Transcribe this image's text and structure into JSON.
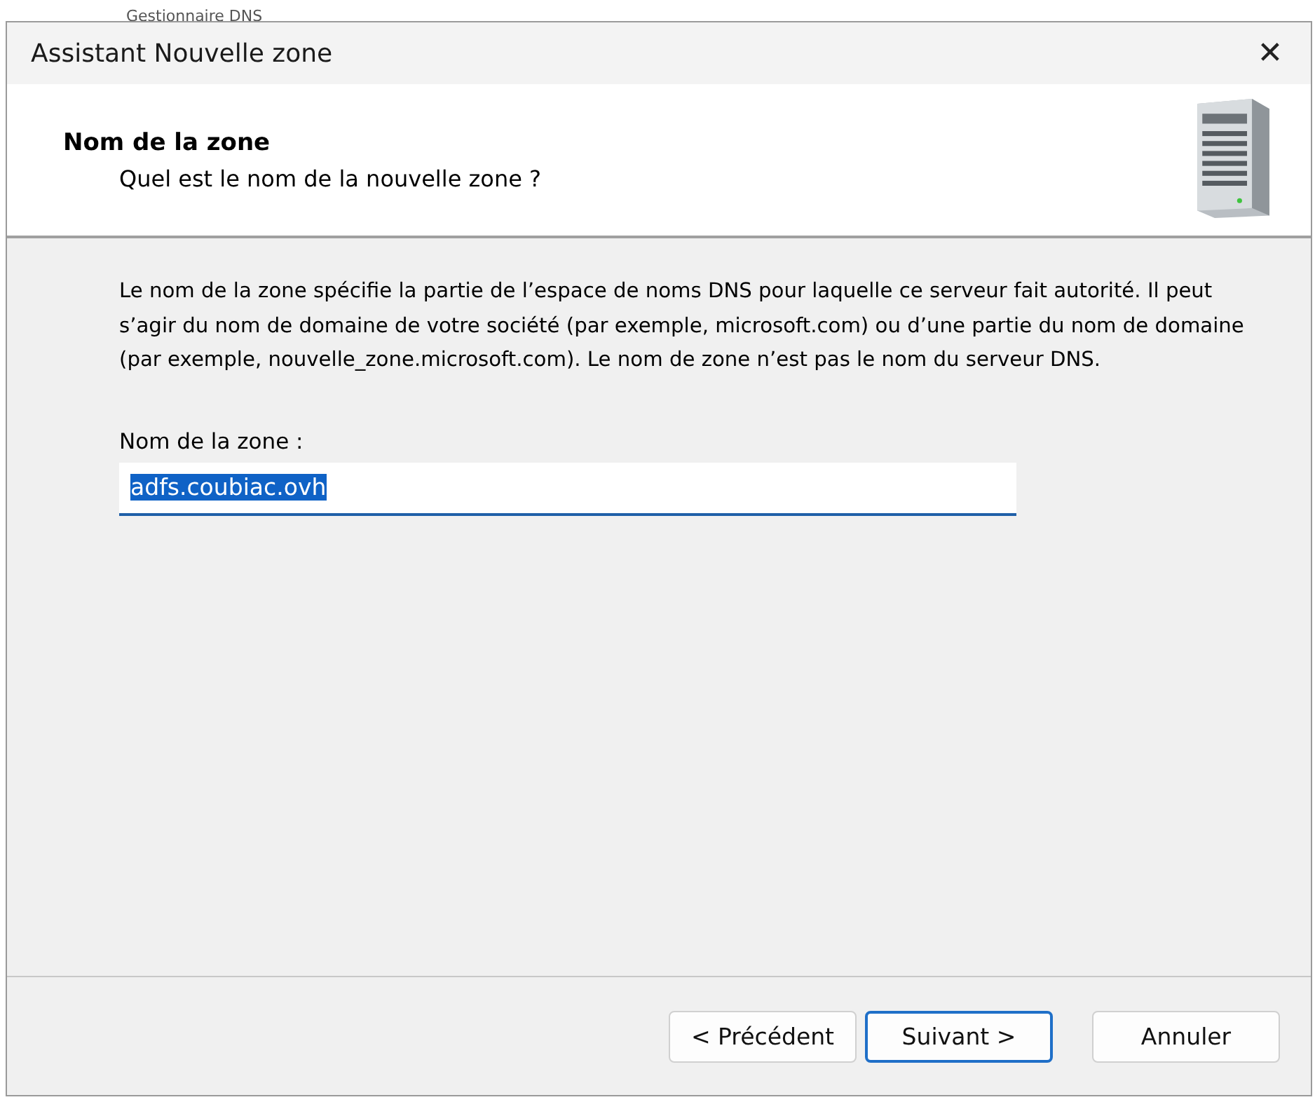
{
  "background_window": {
    "title": "Gestionnaire DNS"
  },
  "window": {
    "title": "Assistant Nouvelle zone",
    "close": "✕"
  },
  "header": {
    "title": "Nom de la zone",
    "subtitle": "Quel est le nom de la nouvelle zone ?"
  },
  "description": "Le nom de la zone spécifie la partie de l’espace de noms DNS pour laquelle ce serveur fait autorité. Il peut s’agir du nom de domaine de votre société (par exemple, microsoft.com) ou d’une partie du nom de domaine (par exemple, nouvelle_zone.microsoft.com). Le nom de zone n’est pas le nom du serveur DNS.",
  "zone_field": {
    "label": "Nom de la zone :",
    "value": "adfs.coubiac.ovh",
    "text_selected": true
  },
  "buttons": [
    {
      "label": "< Précédent",
      "default": false
    },
    {
      "label": "Suivant >",
      "default": true
    },
    {
      "label": "Annuler",
      "default": false
    }
  ]
}
